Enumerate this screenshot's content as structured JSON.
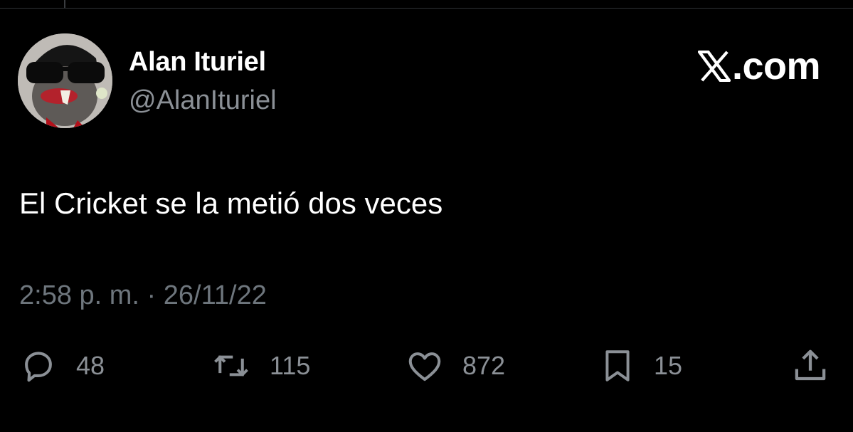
{
  "tweet": {
    "author_name": "Alan Ituriel",
    "handle": "@AlanIturiel",
    "text": "El Cricket se la metió dos veces",
    "time": "2:58 p. m.",
    "separator": "·",
    "date": "26/11/22"
  },
  "brand": {
    "label": ".com",
    "logo": "x-logo-icon"
  },
  "actions": {
    "replies": {
      "icon": "reply-icon",
      "count": "48"
    },
    "retweets": {
      "icon": "retweet-icon",
      "count": "115"
    },
    "likes": {
      "icon": "heart-icon",
      "count": "872"
    },
    "bookmarks": {
      "icon": "bookmark-icon",
      "count": "15"
    },
    "share": {
      "icon": "share-icon"
    }
  },
  "colors": {
    "background": "#000000",
    "text_primary": "#ffffff",
    "text_secondary": "#8b9096"
  }
}
